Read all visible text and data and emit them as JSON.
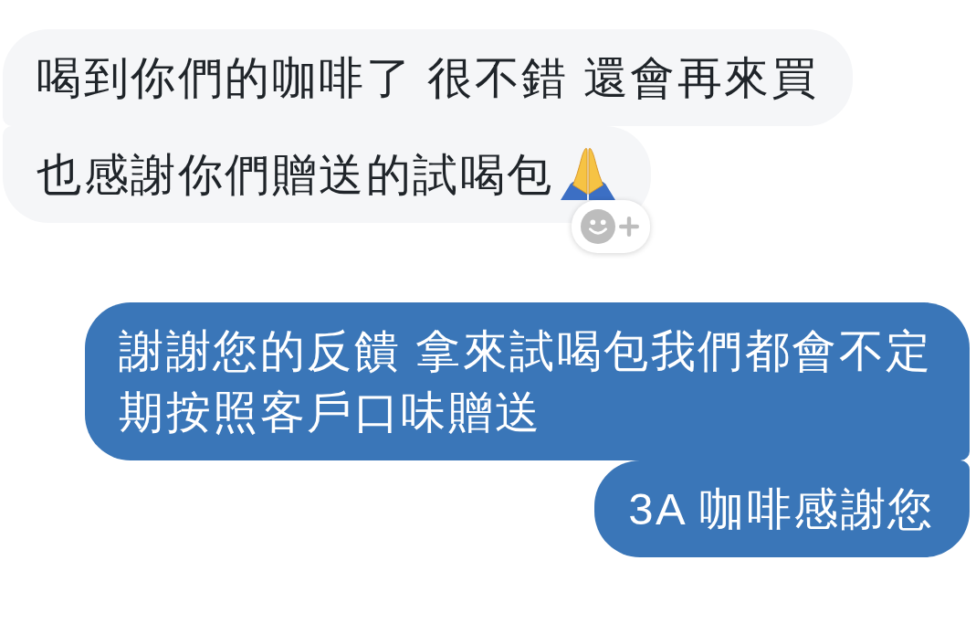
{
  "conversation": {
    "groups": [
      {
        "kind": "received",
        "messages": [
          {
            "text": "喝到你們的咖啡了 很不錯 還會再來買",
            "trailing_emoji": false
          },
          {
            "text": "也感謝你們贈送的試喝包",
            "trailing_emoji": true
          }
        ]
      },
      {
        "kind": "sent",
        "messages": [
          {
            "text": "謝謝您的反饋 拿來試喝包我們都會不定期按照客戶口味贈送",
            "trailing_emoji": false
          },
          {
            "text": "3A 咖啡感謝您",
            "trailing_emoji": false
          }
        ]
      }
    ]
  }
}
